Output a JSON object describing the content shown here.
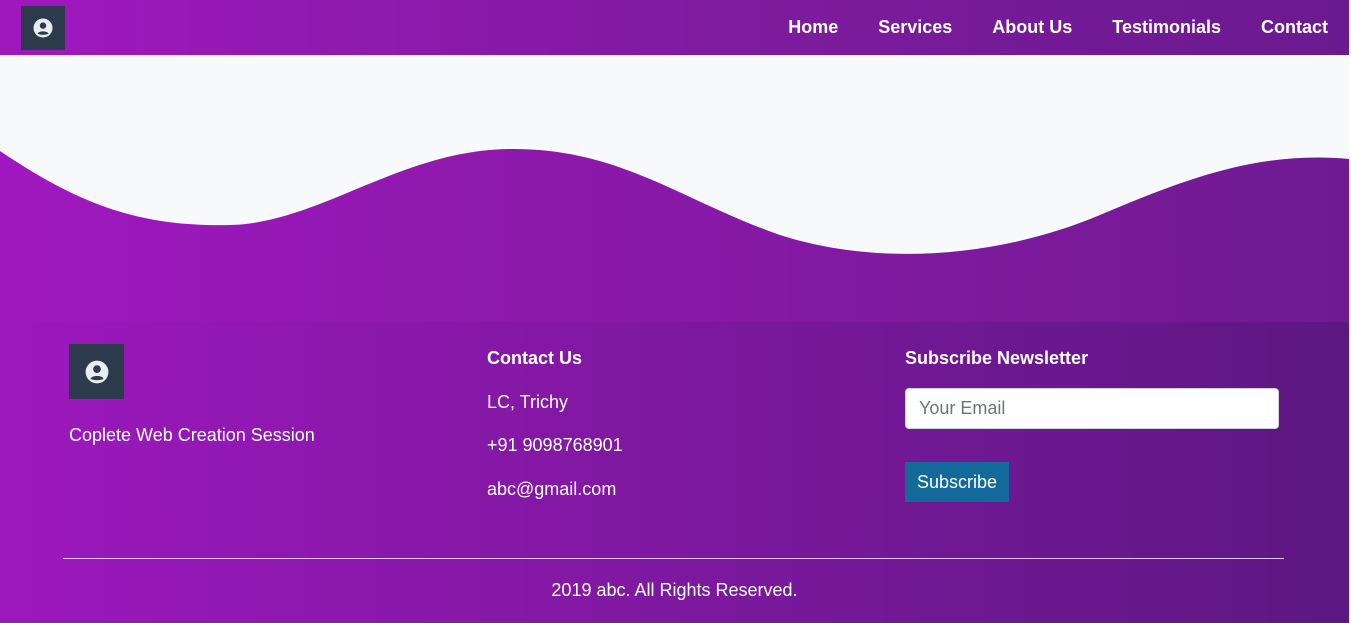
{
  "colors": {
    "nav_gradient": [
      "#9f18bf",
      "#6a1a8f"
    ],
    "footer_gradient": [
      "#9c18bd",
      "#5d1781"
    ],
    "logo_bg": "#2c3a4b",
    "hero_bg": "#f8f9fb",
    "subscribe_bg": "#14699b"
  },
  "navbar": {
    "logo_icon": "user-circle-icon",
    "links": [
      {
        "label": "Home"
      },
      {
        "label": "Services"
      },
      {
        "label": "About Us"
      },
      {
        "label": "Testimonials"
      },
      {
        "label": "Contact"
      }
    ]
  },
  "footer": {
    "logo_icon": "user-circle-icon",
    "tagline": "Coplete Web Creation Session",
    "contact": {
      "title": "Contact Us",
      "address": "LC, Trichy",
      "phone": "+91 9098768901",
      "email": "abc@gmail.com"
    },
    "newsletter": {
      "title": "Subscribe Newsletter",
      "email_placeholder": "Your Email",
      "email_value": "",
      "button_label": "Subscribe"
    },
    "copyright": "2019 abc. All Rights Reserved."
  }
}
